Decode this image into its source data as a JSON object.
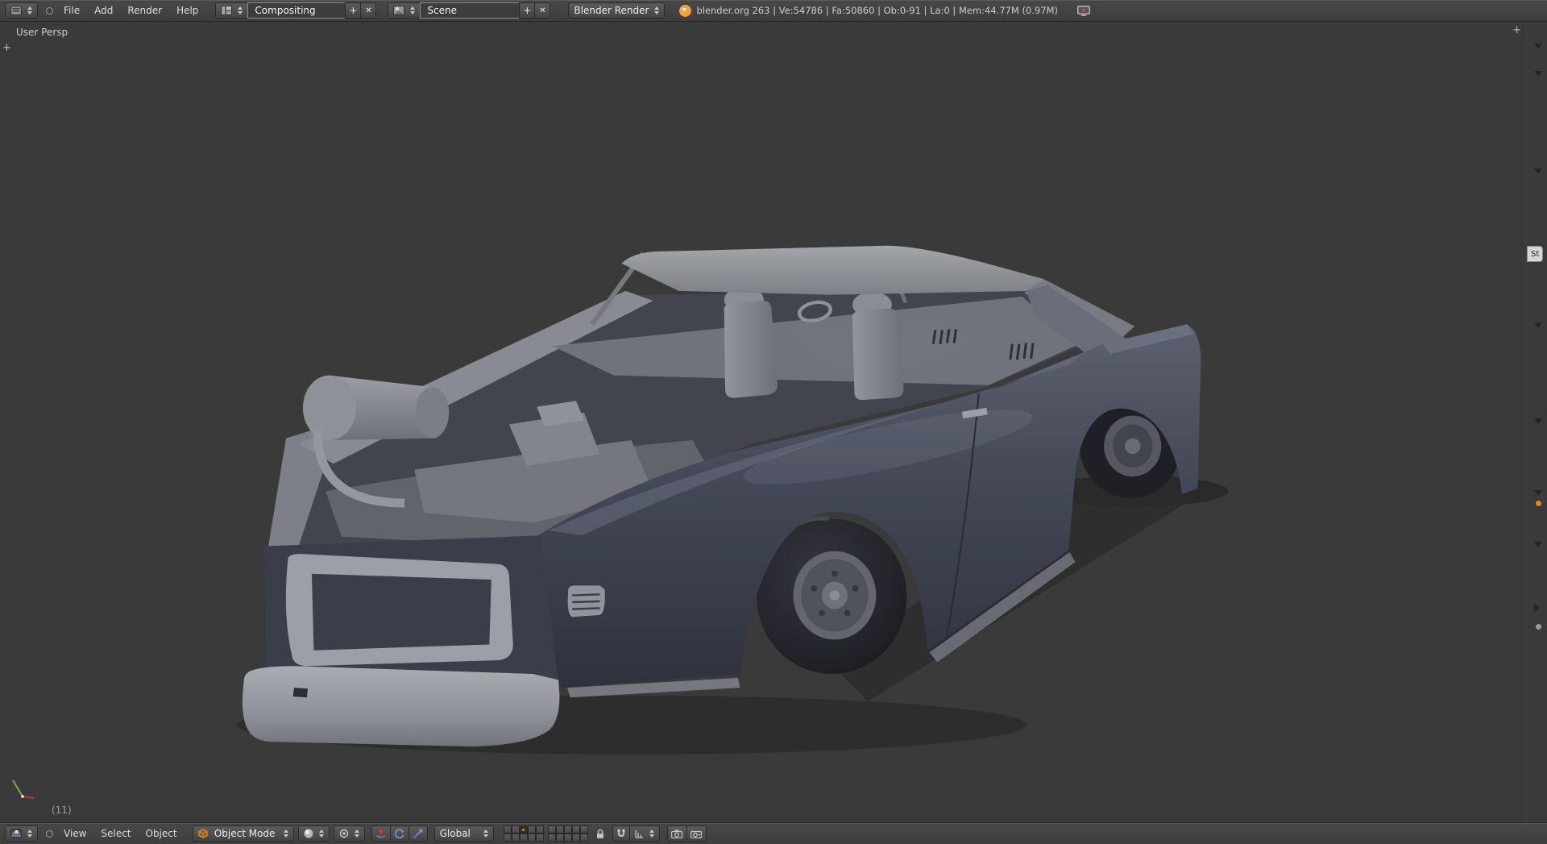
{
  "app": {
    "name": "Blender"
  },
  "colors": {
    "accent": "#e87d0d",
    "axis_x": "#b43a3a",
    "axis_y": "#6fae3f"
  },
  "glyphs": {
    "add": "+",
    "close": "✕"
  },
  "top_header": {
    "menus": [
      "File",
      "Add",
      "Render",
      "Help"
    ],
    "screen_selector": {
      "value": "Compositing"
    },
    "scene_selector": {
      "value": "Scene"
    },
    "render_engine": {
      "value": "Blender Render"
    },
    "stats": "blender.org 263 | Ve:54786 | Fa:50860 | Ob:0-91 | La:0 | Mem:44.77M (0.97M)"
  },
  "viewport": {
    "view_label": "User Persp",
    "frame_label": "(11)"
  },
  "bottom_header": {
    "menus": [
      "View",
      "Select",
      "Object"
    ],
    "mode_selector": {
      "value": "Object Mode"
    },
    "orientation_selector": {
      "value": "Global"
    },
    "layers": {
      "per_group": 10,
      "groups": 2,
      "active_index": 2
    }
  },
  "right_rail": {
    "tab_label": "St"
  }
}
